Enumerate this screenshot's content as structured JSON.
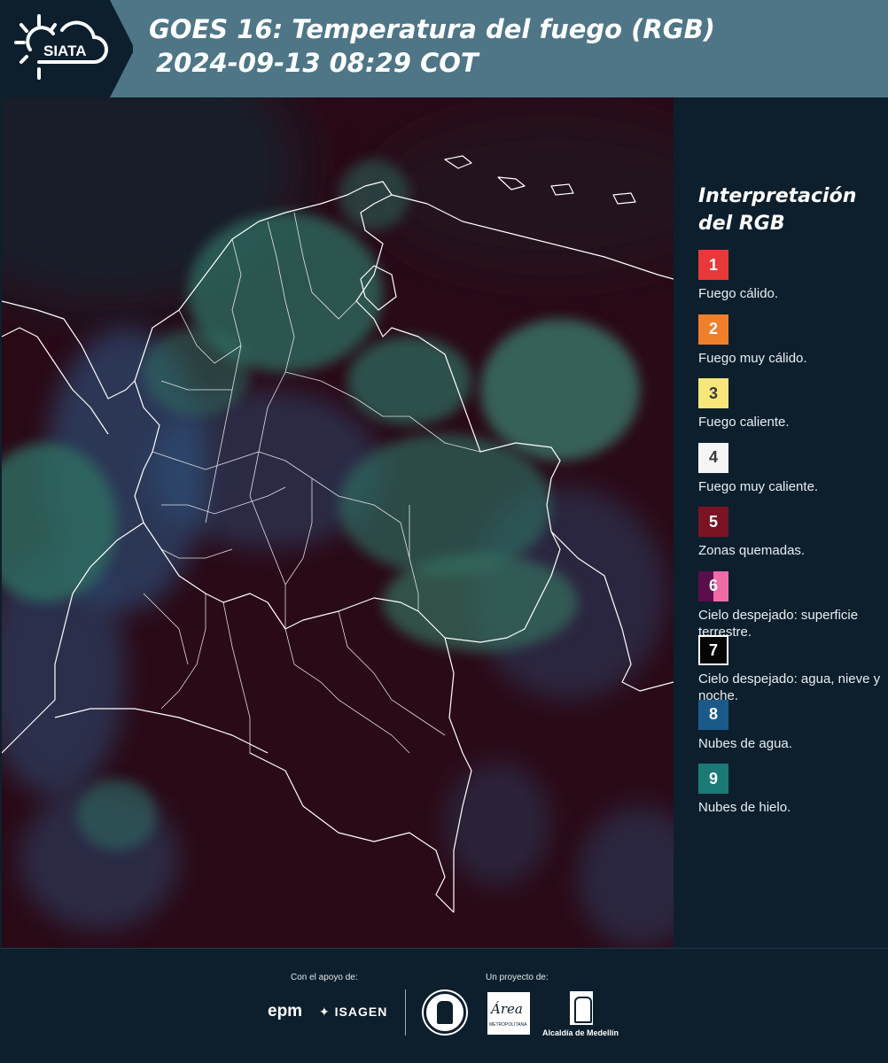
{
  "header": {
    "logo_text": "SIATA",
    "title_line1": "GOES 16: Temperatura del fuego (RGB)",
    "title_line2": "2024-09-13 08:29 COT"
  },
  "legend": {
    "title": "Interpretación del RGB",
    "items": [
      {
        "number": "1",
        "label": "Fuego cálido.",
        "color": "#e8383a",
        "text_color": "#ffffff"
      },
      {
        "number": "2",
        "label": "Fuego muy cálido.",
        "color": "#f07f2a",
        "text_color": "#ffffff"
      },
      {
        "number": "3",
        "label": "Fuego caliente.",
        "color": "#f5e77a",
        "text_color": "#3a3a3a"
      },
      {
        "number": "4",
        "label": "Fuego muy caliente.",
        "color": "#f5f5f5",
        "text_color": "#3a3a3a"
      },
      {
        "number": "5",
        "label": "Zonas quemadas.",
        "color": "#7a1424",
        "text_color": "#ffffff"
      },
      {
        "number": "6",
        "label": "Cielo despejado: superficie terrestre.",
        "color": "#5a0f4a",
        "color2": "#f06aa8",
        "text_color": "#ffffff"
      },
      {
        "number": "7",
        "label": "Cielo despejado: agua, nieve y noche.",
        "color": "#050505",
        "text_color": "#ffffff",
        "border": "#ffffff"
      },
      {
        "number": "8",
        "label": "Nubes de agua.",
        "color": "#1a5a8a",
        "text_color": "#ffffff"
      },
      {
        "number": "9",
        "label": "Nubes de hielo.",
        "color": "#1a7a76",
        "text_color": "#ffffff"
      }
    ]
  },
  "footer": {
    "support_label": "Con el apoyo de:",
    "project_label": "Un proyecto de:",
    "epm": "epm",
    "isagen": "ISAGEN",
    "area_logo": "Área",
    "area_sub": "METROPOLITANA",
    "alcaldia": "Alcaldía de Medellín"
  },
  "map": {
    "background_color": "#2a0a17",
    "border_color": "#ffffff"
  }
}
